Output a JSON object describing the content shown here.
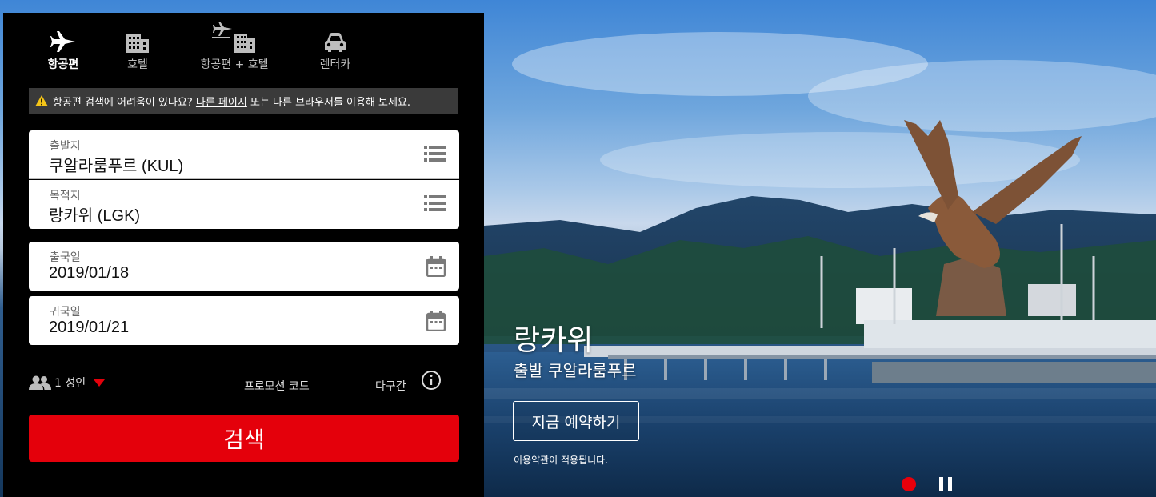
{
  "tabs": [
    {
      "label": "항공편",
      "icon": "airplane-icon",
      "active": true
    },
    {
      "label": "호텔",
      "icon": "hotel-icon",
      "active": false
    },
    {
      "label": "항공편 + 호텔",
      "icon": "flight-hotel-icon",
      "active": false
    },
    {
      "label": "렌터카",
      "icon": "car-icon",
      "active": false
    }
  ],
  "notice": {
    "text_before": "항공편 검색에 어려움이 있나요?",
    "link": "다른 페이지",
    "text_after": "또는 다른 브라우저를 이용해 보세요.",
    "icon": "warning-icon"
  },
  "form": {
    "origin": {
      "label": "출발지",
      "value": "쿠알라룸푸르 (KUL)"
    },
    "destination": {
      "label": "목적지",
      "value": "랑카위 (LGK)"
    },
    "depart": {
      "label": "출국일",
      "value": "2019/01/18"
    },
    "return": {
      "label": "귀국일",
      "value": "2019/01/21"
    }
  },
  "options": {
    "passengers": "1 성인",
    "promo_code": "프로모션 코드",
    "multi_city": "다구간"
  },
  "search_label": "검색",
  "hero": {
    "title": "랑카위",
    "subtitle": "출발 쿠알라룸푸르",
    "book_button": "지금 예약하기",
    "terms": "이용약관이 적용됩니다."
  },
  "colors": {
    "brand_red": "#e4000b",
    "panel_bg": "#000000",
    "notice_bg": "#3a3a3a"
  }
}
